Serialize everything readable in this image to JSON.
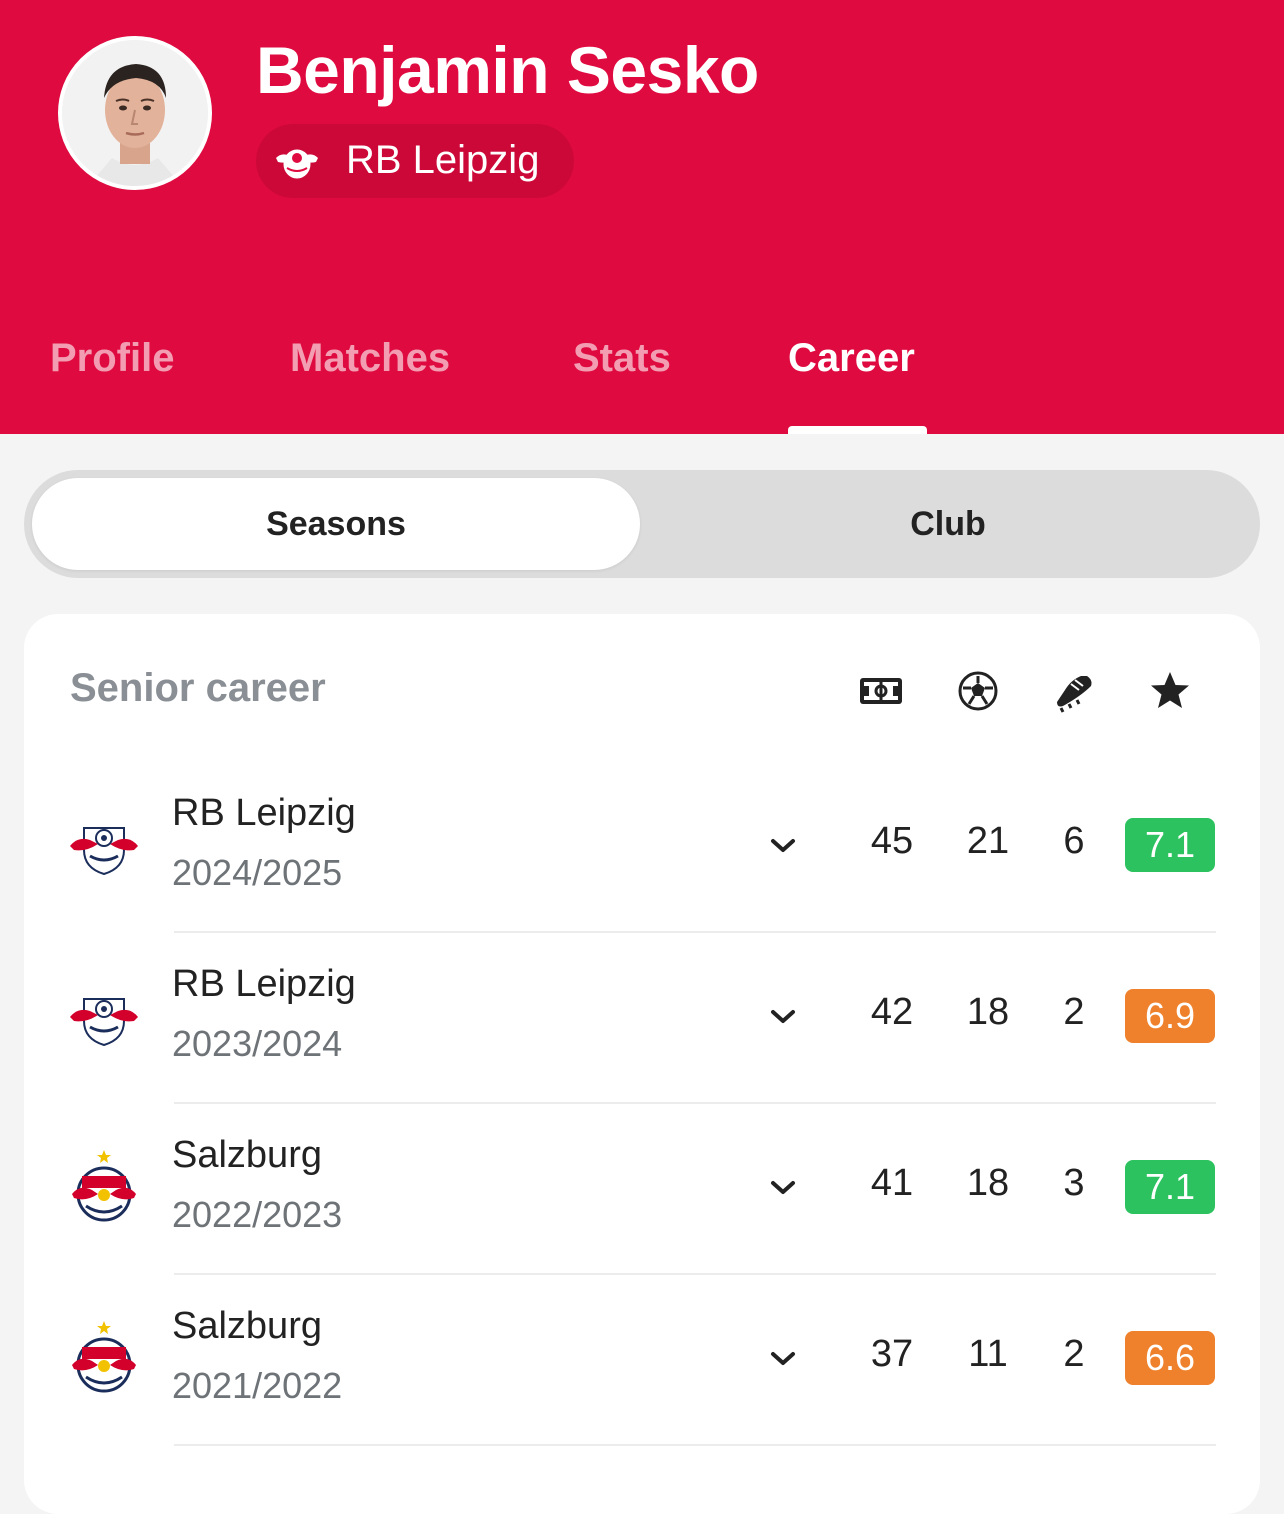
{
  "player": {
    "name": "Benjamin Sesko",
    "club": "RB Leipzig"
  },
  "tabs": [
    {
      "label": "Profile",
      "active": false
    },
    {
      "label": "Matches",
      "active": false
    },
    {
      "label": "Stats",
      "active": false
    },
    {
      "label": "Career",
      "active": true
    }
  ],
  "segmented": {
    "seasons": "Seasons",
    "club": "Club",
    "selected": "Seasons"
  },
  "career": {
    "title": "Senior career",
    "columns": [
      "pitch-icon",
      "football-icon",
      "boot-icon",
      "star-icon"
    ],
    "rows": [
      {
        "club": "RB Leipzig",
        "season": "2024/2025",
        "apps": "45",
        "goals": "21",
        "assists": "6",
        "rating": "7.1",
        "rating_color": "#2bc25f",
        "logo": "rb-leipzig"
      },
      {
        "club": "RB Leipzig",
        "season": "2023/2024",
        "apps": "42",
        "goals": "18",
        "assists": "2",
        "rating": "6.9",
        "rating_color": "#f0812c",
        "logo": "rb-leipzig"
      },
      {
        "club": "Salzburg",
        "season": "2022/2023",
        "apps": "41",
        "goals": "18",
        "assists": "3",
        "rating": "7.1",
        "rating_color": "#2bc25f",
        "logo": "salzburg"
      },
      {
        "club": "Salzburg",
        "season": "2021/2022",
        "apps": "37",
        "goals": "11",
        "assists": "2",
        "rating": "6.6",
        "rating_color": "#f0812c",
        "logo": "salzburg"
      }
    ]
  },
  "colors": {
    "header_red": "#df0a3f",
    "rating_green": "#2bc25f",
    "rating_orange": "#f0812c"
  }
}
